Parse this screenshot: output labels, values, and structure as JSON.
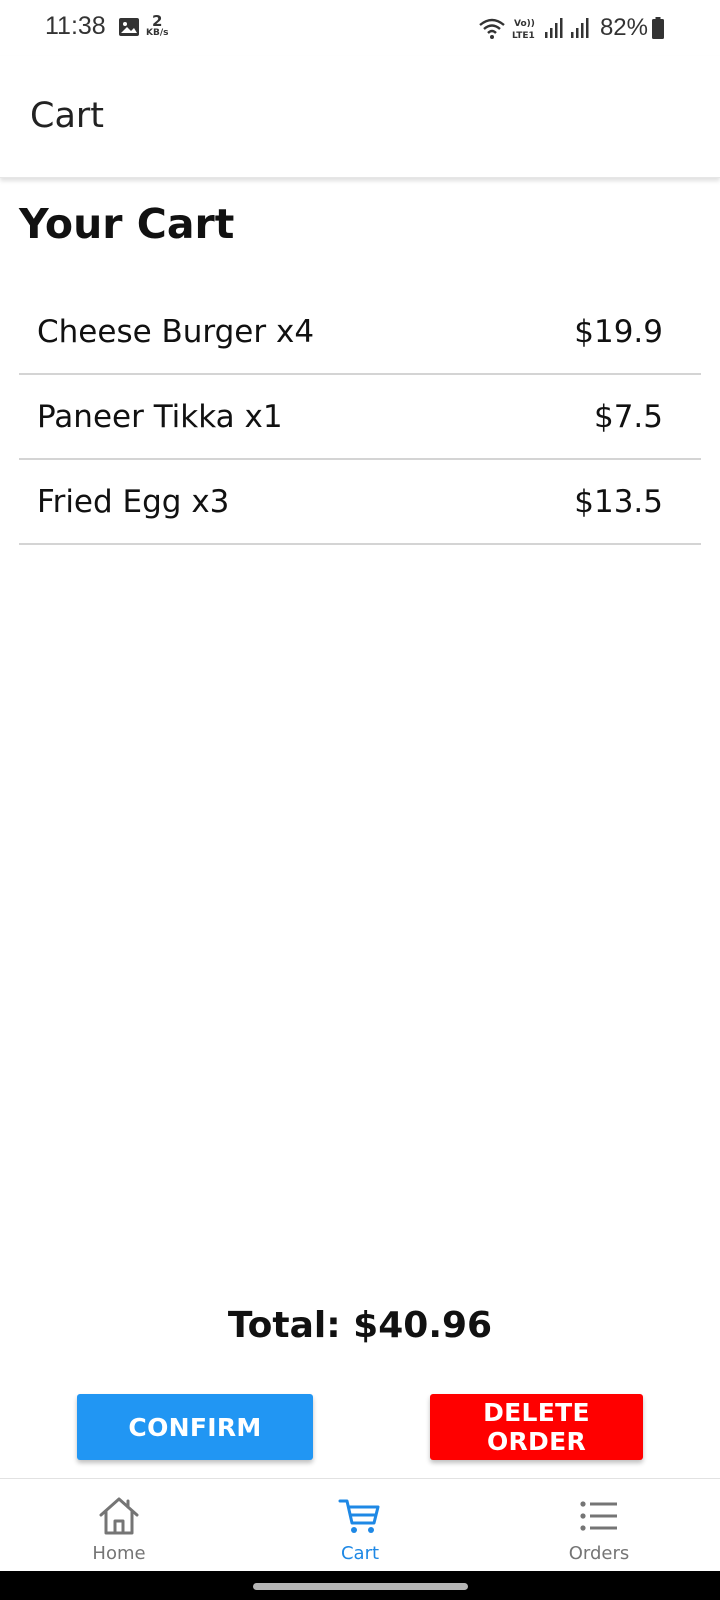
{
  "status_bar": {
    "time": "11:38",
    "net_speed_value": "2",
    "net_speed_unit": "KB/s",
    "volte_label": "Vo))\nLTE1",
    "battery": "82%"
  },
  "app_bar": {
    "title": "Cart"
  },
  "page": {
    "title": "Your Cart"
  },
  "cart": {
    "items": [
      {
        "name": "Cheese Burger x4",
        "price": "$19.9"
      },
      {
        "name": "Paneer Tikka x1",
        "price": "$7.5"
      },
      {
        "name": "Fried Egg x3",
        "price": "$13.5"
      }
    ],
    "total": "Total: $40.96"
  },
  "actions": {
    "confirm_label": "CONFIRM",
    "delete_label": "DELETE ORDER",
    "confirm_color": "#2196F3",
    "delete_color": "#FF0000"
  },
  "bottom_nav": {
    "items": [
      {
        "label": "Home",
        "icon": "home-icon"
      },
      {
        "label": "Cart",
        "icon": "cart-icon",
        "active": true
      },
      {
        "label": "Orders",
        "icon": "list-icon"
      }
    ],
    "active_color": "#1E88E5"
  }
}
